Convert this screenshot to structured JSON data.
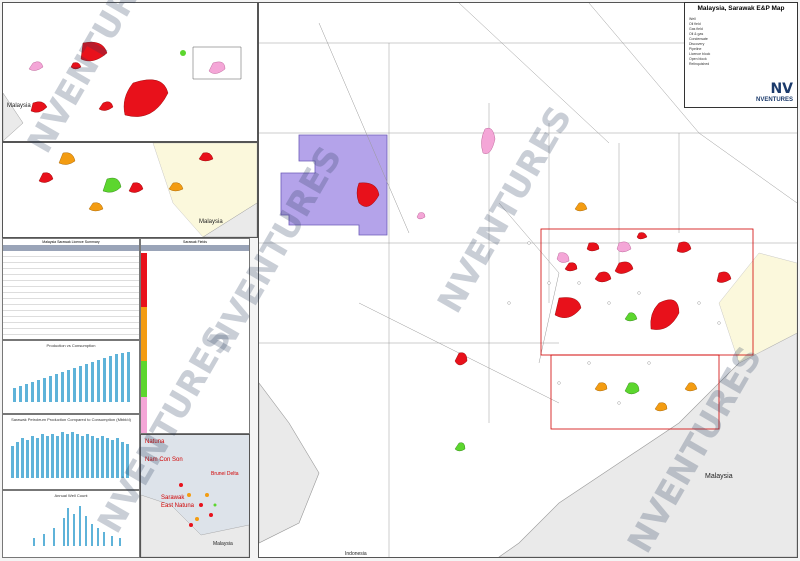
{
  "map_title": "Malaysia, Sarawak E&P Map",
  "brand": {
    "name": "NVENTURES",
    "mark": "NV",
    "accent": "#1b3a6b",
    "watermark_color": "#4a6fa5"
  },
  "country_labels": {
    "main_malaysia": "Malaysia",
    "main_indonesia": "Indonesia",
    "inset1_malaysia": "Malaysia",
    "inset2_malaysia": "Malaysia"
  },
  "basin_labels": [
    "Natuna",
    "Nam Con Son",
    "Sarawak",
    "East Natuna",
    "Brunei Delta"
  ],
  "watermark_text": "NVENTURES",
  "colors": {
    "oil": "#e8111b",
    "gas": "#f4a6d7",
    "condensate": "#f39c12",
    "licence_purple": "#b4a3ea",
    "discovery_green": "#5cd62e",
    "land": "#f2f2f2"
  },
  "legend_items": [
    "Well",
    "Oil field",
    "Gas field",
    "Oil & gas",
    "Condensate",
    "Discovery",
    "Pipeline",
    "Licence block",
    "Open block",
    "Relinquished"
  ],
  "table_titles": [
    "Malaysia Sarawak Licence Summary",
    "Sarawak Fields"
  ],
  "chart_titles": [
    "Production vs Consumption",
    "Sarawak Petroleum Production Compared to Consumption (Mbbl/d)",
    "Annual Well Count"
  ]
}
